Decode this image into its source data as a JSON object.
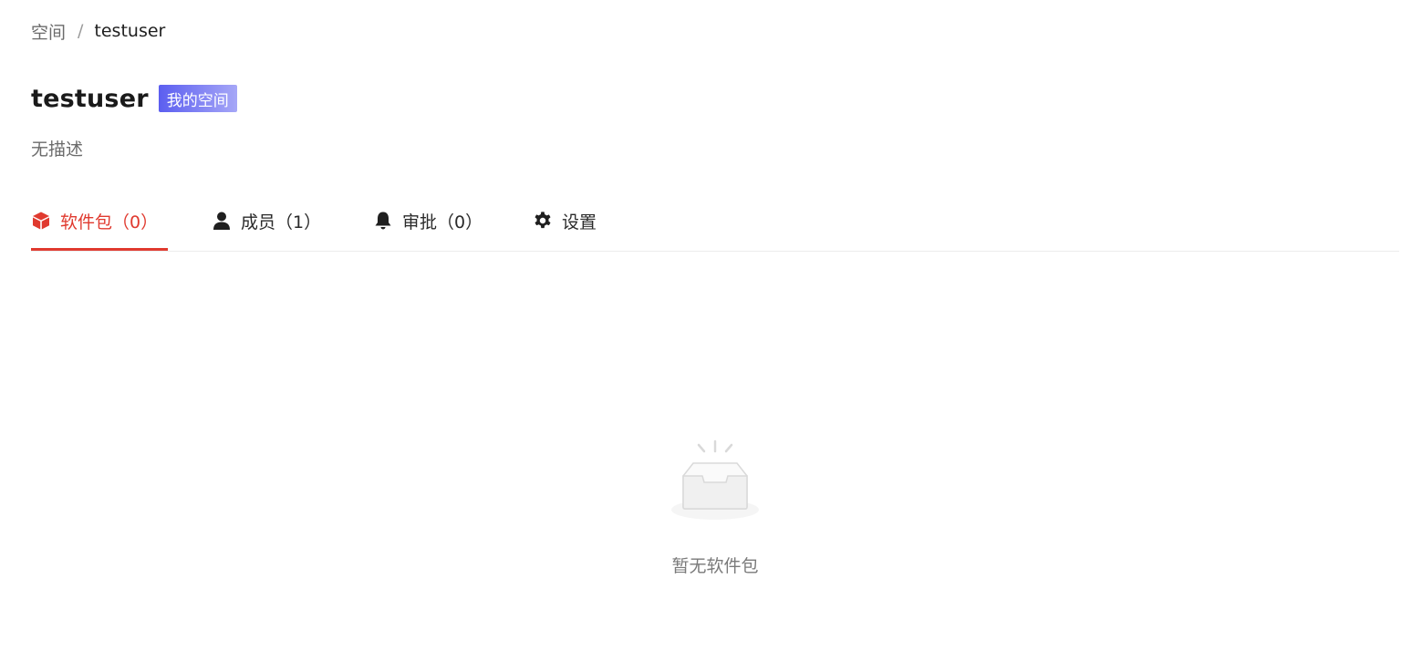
{
  "breadcrumb": {
    "root": "空间",
    "separator": "/",
    "current": "testuser"
  },
  "header": {
    "title": "testuser",
    "badge": "我的空间",
    "description": "无描述"
  },
  "tabs": [
    {
      "label": "软件包（0）",
      "icon": "cube-icon",
      "active": true
    },
    {
      "label": "成员（1）",
      "icon": "user-icon",
      "active": false
    },
    {
      "label": "审批（0）",
      "icon": "bell-icon",
      "active": false
    },
    {
      "label": "设置",
      "icon": "gear-icon",
      "active": false
    }
  ],
  "empty_state": {
    "icon": "empty-inbox-icon",
    "text": "暂无软件包"
  },
  "colors": {
    "accent": "#e03a2f",
    "badge_start": "#5b5ef0",
    "badge_end": "#a6a7f7",
    "muted_text": "#6b6b6b"
  }
}
